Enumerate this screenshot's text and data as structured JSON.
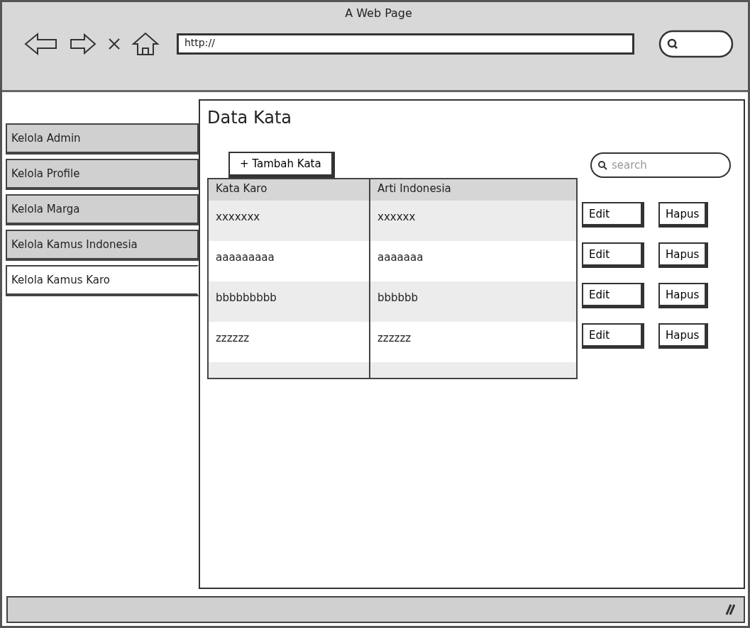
{
  "window": {
    "title": "A Web Page"
  },
  "address_bar": {
    "value": "http://"
  },
  "sidebar": {
    "items": [
      {
        "label": "Kelola Admin",
        "selected": false
      },
      {
        "label": "Kelola Profile",
        "selected": false
      },
      {
        "label": "Kelola Marga",
        "selected": false
      },
      {
        "label": "Kelola Kamus Indonesia",
        "selected": false
      },
      {
        "label": "Kelola Kamus Karo",
        "selected": true
      }
    ]
  },
  "content": {
    "title": "Data Kata",
    "add_button": "+ Tambah Kata",
    "search": {
      "placeholder": "search"
    },
    "table": {
      "columns": [
        "Kata Karo",
        "Arti Indonesia"
      ],
      "rows": [
        {
          "cells": [
            "xxxxxxx",
            "xxxxxx"
          ],
          "actions": [
            "Edit",
            "Hapus"
          ]
        },
        {
          "cells": [
            "aaaaaaaaa",
            "aaaaaaa"
          ],
          "actions": [
            "Edit",
            "Hapus"
          ]
        },
        {
          "cells": [
            "bbbbbbbbb",
            "bbbbbb"
          ],
          "actions": [
            "Edit",
            "Hapus"
          ]
        },
        {
          "cells": [
            "zzzzzz",
            "zzzzzz"
          ],
          "actions": [
            "Edit",
            "Hapus"
          ]
        }
      ]
    }
  }
}
